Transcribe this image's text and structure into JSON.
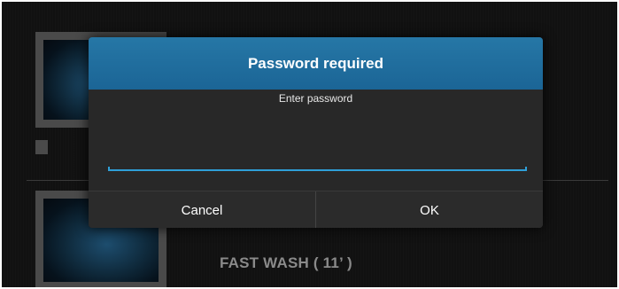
{
  "background": {
    "program_label": "FAST WASH ( 11’ )"
  },
  "dialog": {
    "title": "Password required",
    "message": "Enter password",
    "password_value": "",
    "cancel_label": "Cancel",
    "ok_label": "OK"
  },
  "colors": {
    "header": "#1f6a9a",
    "accent": "#2f9fd8",
    "dialog_bg": "#262626"
  }
}
